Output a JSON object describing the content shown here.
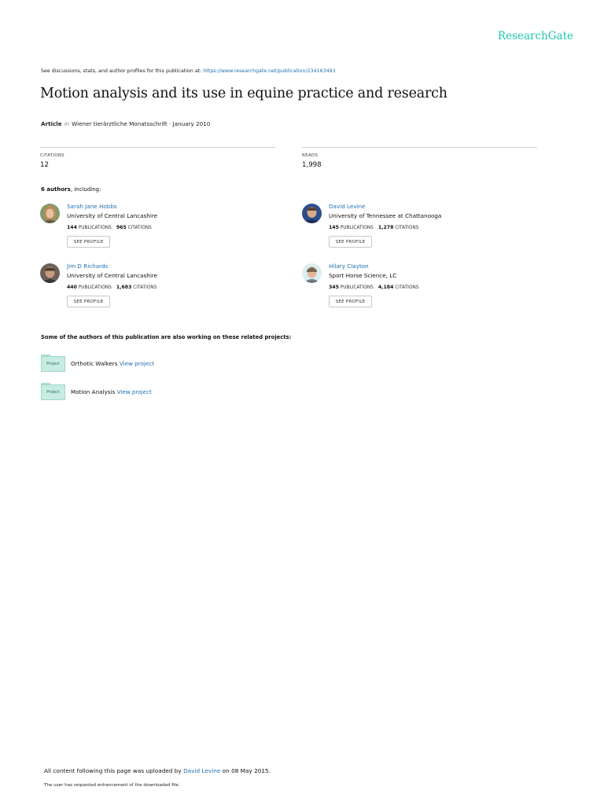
{
  "brand": "ResearchGate",
  "discussion": {
    "prefix": "See discussions, stats, and author profiles for this publication at:",
    "url": "https://www.researchgate.net/publication/234163493"
  },
  "title": "Motion analysis and its use in equine practice and research",
  "meta": {
    "type": "Article",
    "in": "in",
    "journal": "Wiener tierärztliche Monatsschrift · January 2010"
  },
  "stats": {
    "citations_label": "CITATIONS",
    "citations": "12",
    "reads_label": "READS",
    "reads": "1,998"
  },
  "authors_head": {
    "count": "6 authors",
    "suffix": ", including:"
  },
  "authors": [
    {
      "name": "Sarah Jane Hobbs",
      "institution": "University of Central Lancashire",
      "publications": "144",
      "citations": "965",
      "publications_label": "PUBLICATIONS",
      "citations_label": "CITATIONS",
      "button": "SEE PROFILE"
    },
    {
      "name": "David Levine",
      "institution": "University of Tennessee at Chattanooga",
      "publications": "145",
      "citations": "1,278",
      "publications_label": "PUBLICATIONS",
      "citations_label": "CITATIONS",
      "button": "SEE PROFILE"
    },
    {
      "name": "Jim D Richards",
      "institution": "University of Central Lancashire",
      "publications": "440",
      "citations": "1,683",
      "publications_label": "PUBLICATIONS",
      "citations_label": "CITATIONS",
      "button": "SEE PROFILE"
    },
    {
      "name": "Hilary Clayton",
      "institution": "Sport Horse Science, LC",
      "publications": "345",
      "citations": "4,184",
      "publications_label": "PUBLICATIONS",
      "citations_label": "CITATIONS",
      "button": "SEE PROFILE"
    }
  ],
  "projects_head": "Some of the authors of this publication are also working on these related projects:",
  "projects": [
    {
      "icon_label": "Project",
      "name": "Orthotic Walkers",
      "link": "View project"
    },
    {
      "icon_label": "Project",
      "name": "Motion Analysis",
      "link": "View project"
    }
  ],
  "footer": {
    "upload_prefix": "All content following this page was uploaded by",
    "uploader": "David Levine",
    "upload_suffix": "on 08 May 2015.",
    "request": "The user has requested enhancement of the downloaded file."
  },
  "colors": {
    "brand": "#1fc9a9",
    "link": "#1e6fb0",
    "project_folder": "#c7ece3"
  }
}
